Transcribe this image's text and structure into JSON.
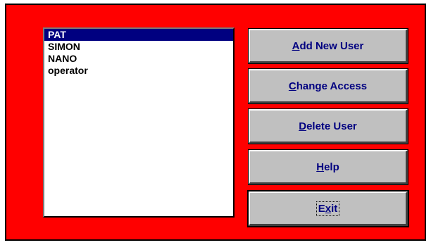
{
  "users": [
    {
      "name": "PAT",
      "selected": true
    },
    {
      "name": "SIMON",
      "selected": false
    },
    {
      "name": "NANO",
      "selected": false
    },
    {
      "name": "operator",
      "selected": false
    }
  ],
  "buttons": {
    "add": {
      "pre": "",
      "key": "A",
      "post": "dd New User"
    },
    "change": {
      "pre": "",
      "key": "C",
      "post": "hange Access"
    },
    "delete": {
      "pre": "",
      "key": "D",
      "post": "elete User"
    },
    "help": {
      "pre": "",
      "key": "H",
      "post": "elp"
    },
    "exit": {
      "pre": "E",
      "key": "x",
      "post": "it"
    }
  },
  "colors": {
    "window_background": "#ff0000",
    "selection": "#000080",
    "button_face": "#c0c0c0",
    "button_text": "#000080"
  }
}
